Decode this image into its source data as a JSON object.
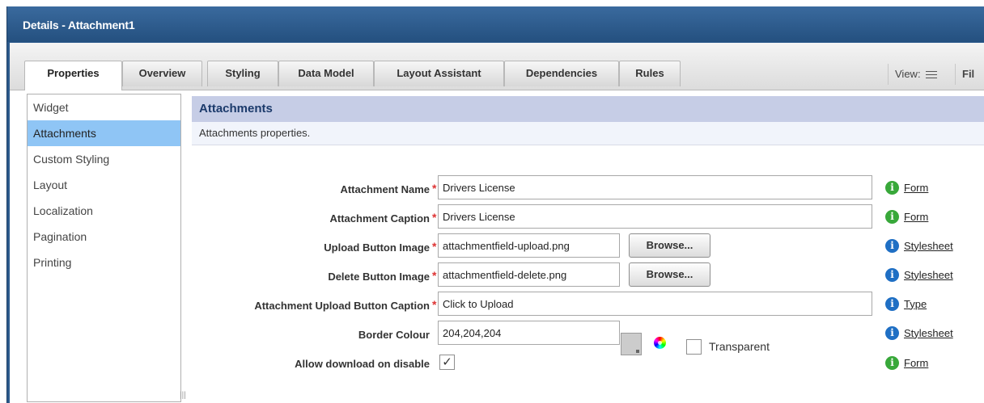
{
  "window": {
    "title": "Details - Attachment1"
  },
  "tabs": [
    {
      "label": "Properties"
    },
    {
      "label": "Overview"
    },
    {
      "label": "Styling"
    },
    {
      "label": "Data Model"
    },
    {
      "label": "Layout Assistant"
    },
    {
      "label": "Dependencies"
    },
    {
      "label": "Rules"
    }
  ],
  "view": {
    "label": "View:",
    "filter_label": "Fil"
  },
  "nav": [
    {
      "label": "Widget"
    },
    {
      "label": "Attachments"
    },
    {
      "label": "Custom Styling"
    },
    {
      "label": "Layout"
    },
    {
      "label": "Localization"
    },
    {
      "label": "Pagination"
    },
    {
      "label": "Printing"
    }
  ],
  "section": {
    "title": "Attachments",
    "description": "Attachments properties."
  },
  "fields": {
    "attachment_name": {
      "label": "Attachment Name",
      "value": "Drivers License",
      "help": "Form"
    },
    "attachment_caption": {
      "label": "Attachment Caption",
      "value": "Drivers License",
      "help": "Form"
    },
    "upload_image": {
      "label": "Upload Button Image",
      "value": "attachmentfield-upload.png",
      "button": "Browse...",
      "help": "Stylesheet"
    },
    "delete_image": {
      "label": "Delete Button Image",
      "value": "attachmentfield-delete.png",
      "button": "Browse...",
      "help": "Stylesheet"
    },
    "upload_caption": {
      "label": "Attachment Upload Button Caption",
      "value": "Click to Upload",
      "help": "Type"
    },
    "border_colour": {
      "label": "Border Colour",
      "value": "204,204,204",
      "swatch_color": "#cccccc",
      "transparent_label": "Transparent",
      "help": "Stylesheet"
    },
    "allow_download": {
      "label": "Allow download on disable",
      "checked": true,
      "check_mark": "✓",
      "help": "Form"
    }
  },
  "required_mark": "*",
  "colors": {
    "titlebar": "#2c5a8c",
    "selected_nav": "#8fc5f5",
    "section_header": "#c6cde6",
    "info_green": "#38a83a",
    "info_blue": "#1f6fc4"
  }
}
